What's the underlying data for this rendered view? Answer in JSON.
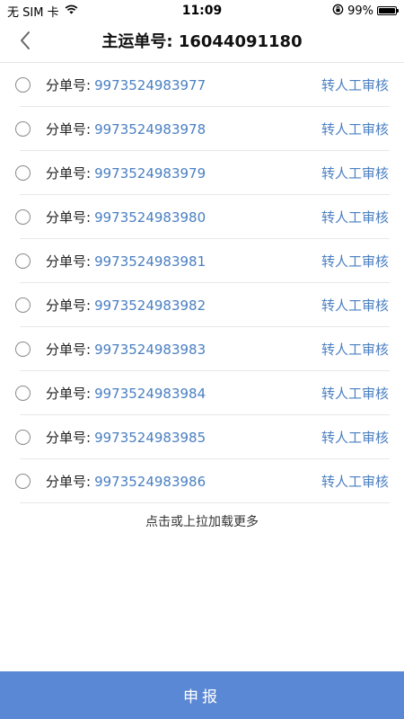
{
  "status_bar": {
    "carrier": "无 SIM 卡",
    "time": "11:09",
    "battery_percent": "99%",
    "battery_level": 0.99,
    "icons": [
      "wifi-icon",
      "orientation-lock-icon",
      "battery-icon"
    ]
  },
  "nav": {
    "back_icon": "chevron-left-icon",
    "title": "主运单号: 16044091180"
  },
  "list": {
    "items": [
      {
        "label": "分单号:",
        "number": "9973524983977",
        "action": "转人工审核"
      },
      {
        "label": "分单号:",
        "number": "9973524983978",
        "action": "转人工审核"
      },
      {
        "label": "分单号:",
        "number": "9973524983979",
        "action": "转人工审核"
      },
      {
        "label": "分单号:",
        "number": "9973524983980",
        "action": "转人工审核"
      },
      {
        "label": "分单号:",
        "number": "9973524983981",
        "action": "转人工审核"
      },
      {
        "label": "分单号:",
        "number": "9973524983982",
        "action": "转人工审核"
      },
      {
        "label": "分单号:",
        "number": "9973524983983",
        "action": "转人工审核"
      },
      {
        "label": "分单号:",
        "number": "9973524983984",
        "action": "转人工审核"
      },
      {
        "label": "分单号:",
        "number": "9973524983985",
        "action": "转人工审核"
      },
      {
        "label": "分单号:",
        "number": "9973524983986",
        "action": "转人工审核"
      }
    ],
    "load_more": "点击或上拉加载更多"
  },
  "submit": {
    "label": "申报"
  },
  "colors": {
    "accent": "#4a7fc1",
    "submit_bg": "#5b88d4"
  }
}
